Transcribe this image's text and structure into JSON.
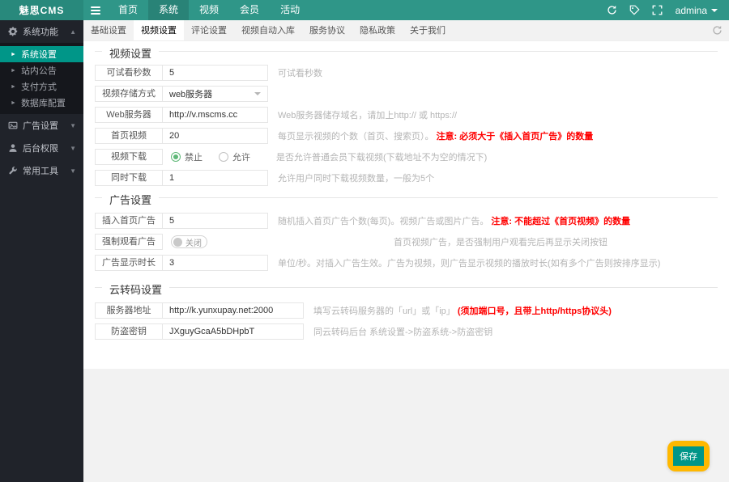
{
  "topbar": {
    "logo": "魅思CMS",
    "nav_items": [
      {
        "label": "首页"
      },
      {
        "label": "系统"
      },
      {
        "label": "视频"
      },
      {
        "label": "会员"
      },
      {
        "label": "活动"
      }
    ],
    "active_nav": "系统",
    "username": "admina",
    "icons": {
      "menu": "hamburger-menu",
      "clear_cache": "refresh-circular-arrow",
      "tag": "price-tag",
      "fullscreen": "expand-corners",
      "user_caret": "chevron-down"
    }
  },
  "sidebar": {
    "sections": [
      {
        "label": "系统功能",
        "icon": "gear-icon",
        "expanded": true
      },
      {
        "label": "广告设置",
        "icon": "ad-image-icon",
        "expanded": false
      },
      {
        "label": "后台权限",
        "icon": "user-icon",
        "expanded": false
      },
      {
        "label": "常用工具",
        "icon": "wrench-icon",
        "expanded": false
      }
    ],
    "system_items": [
      {
        "label": "系统设置",
        "active": true
      },
      {
        "label": "站内公告",
        "active": false
      },
      {
        "label": "支付方式",
        "active": false
      },
      {
        "label": "数据库配置",
        "active": false
      }
    ]
  },
  "tabs": [
    {
      "label": "基础设置"
    },
    {
      "label": "视频设置"
    },
    {
      "label": "评论设置"
    },
    {
      "label": "视频自动入库"
    },
    {
      "label": "服务协议"
    },
    {
      "label": "隐私政策"
    },
    {
      "label": "关于我们"
    }
  ],
  "active_tab": "视频设置",
  "video_settings": {
    "title": "视频设置",
    "trial_seconds": {
      "label": "可试看秒数",
      "value": "5",
      "hint": "可试看秒数"
    },
    "storage_mode": {
      "label": "视频存储方式",
      "value": "web服务器"
    },
    "web_server": {
      "label": "Web服务器",
      "value": "http://v.mscms.cc",
      "hint": "Web服务器储存域名，请加上http:// 或 https://"
    },
    "home_videos": {
      "label": "首页视频",
      "value": "20",
      "hint": "每页显示视频的个数（首页、搜索页）。",
      "hint_red": "注意: 必须大于《插入首页广告》的数量"
    },
    "video_download": {
      "label": "视频下载",
      "options": [
        "禁止",
        "允许"
      ],
      "selected": "禁止",
      "hint": "是否允许普通会员下载视频(下载地址不为空的情况下)"
    },
    "concurrent_download": {
      "label": "同时下载",
      "value": "1",
      "hint": "允许用户同时下载视频数量，一般为5个"
    }
  },
  "ad_settings": {
    "title": "广告设置",
    "home_ads": {
      "label": "插入首页广告",
      "value": "5",
      "hint": "随机插入首页广告个数(每页)。视频广告或图片广告。",
      "hint_red": "注意: 不能超过《首页视频》的数量"
    },
    "force_watch": {
      "label": "强制观看广告",
      "value": "关闭",
      "hint": "首页视频广告，是否强制用户观看完后再显示关闭按钮"
    },
    "ad_duration": {
      "label": "广告显示时长",
      "value": "3",
      "hint": "单位/秒。对插入广告生效。广告为视频，则广告显示视频的播放时长(如有多个广告则按排序显示)"
    }
  },
  "transcode_settings": {
    "title": "云转码设置",
    "server_addr": {
      "label": "服务器地址",
      "value": "http://k.yunxupay.net:2000",
      "hint": "填写云转码服务器的「url」或「ip」",
      "hint_red": "(须加端口号，且带上http/https协议头)"
    },
    "secret_key": {
      "label": "防盗密钥",
      "value": "JXguyGcaA5bDHpbT",
      "hint": "同云转码后台 系统设置->防盗系统->防盗密钥"
    }
  },
  "save_button": "保存"
}
